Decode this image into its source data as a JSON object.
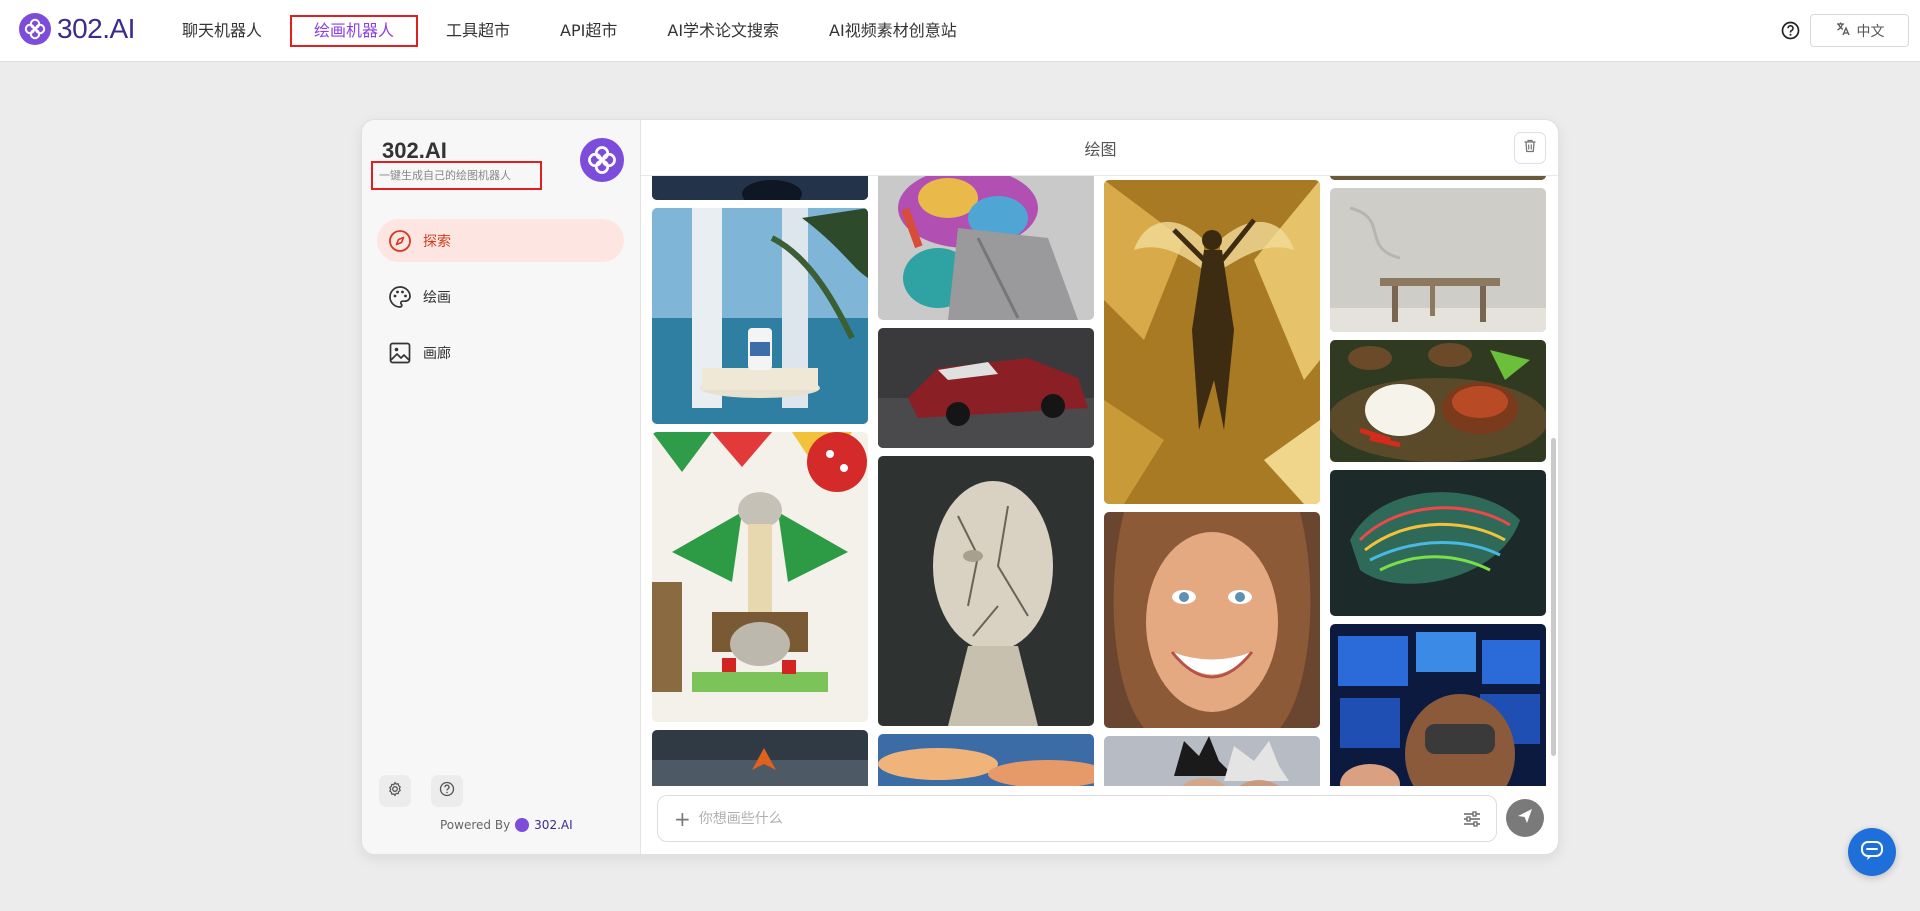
{
  "app": {
    "brand_number": "302",
    "brand_suffix": ".AI"
  },
  "nav": {
    "items": [
      {
        "label": "聊天机器人"
      },
      {
        "label": "绘画机器人",
        "active": true
      },
      {
        "label": "工具超市"
      },
      {
        "label": "API超市"
      },
      {
        "label": "AI学术论文搜索"
      },
      {
        "label": "AI视频素材创意站"
      }
    ]
  },
  "header": {
    "help_icon": "question-circle-icon",
    "language_label": "中文",
    "language_icon": "translate-icon"
  },
  "sidebar": {
    "title": "302.AI",
    "subtitle": "一键生成自己的绘图机器人",
    "menu": [
      {
        "label": "探索",
        "icon": "compass-icon",
        "active": true
      },
      {
        "label": "绘画",
        "icon": "palette-icon"
      },
      {
        "label": "画廊",
        "icon": "image-icon"
      }
    ],
    "footer": {
      "powered_by": "Powered By",
      "brand": "302.AI"
    }
  },
  "main": {
    "title": "绘图",
    "composer": {
      "placeholder": "你想画些什么"
    },
    "gallery": [
      {
        "subject": "ocean-dark-cropped"
      },
      {
        "subject": "bottle-on-pedestal-ocean"
      },
      {
        "subject": "cat-on-festive-tree"
      },
      {
        "subject": "stormy-orange-leaf"
      },
      {
        "subject": "rainbow-fur-hooded-figure"
      },
      {
        "subject": "red-sports-car"
      },
      {
        "subject": "cracked-stone-head"
      },
      {
        "subject": "sunset-sky"
      },
      {
        "subject": "golden-glass-fairy"
      },
      {
        "subject": "smiling-woman-portrait"
      },
      {
        "subject": "silver-haired-figures"
      },
      {
        "subject": "dark-strip-top"
      },
      {
        "subject": "wooden-stool-white-wall"
      },
      {
        "subject": "rice-and-dishes"
      },
      {
        "subject": "neon-feathered-dragon"
      },
      {
        "subject": "vr-headset-monitors"
      }
    ]
  },
  "colors": {
    "accent": "#7c4ddb",
    "active_bg": "#fde6e2",
    "active_text": "#d43a1f",
    "highlight_box": "#e02020",
    "fab": "#1e6fd9"
  }
}
